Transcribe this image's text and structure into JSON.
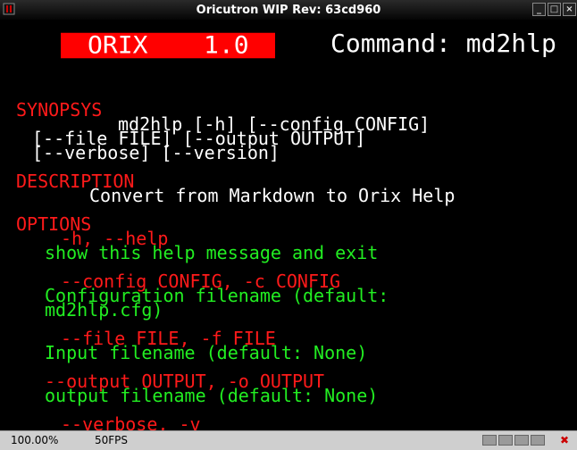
{
  "window": {
    "title": "Oricutron WIP Rev: 63cd960",
    "menu_icon": "window-menu-icon",
    "buttons": {
      "minimize": "_",
      "maximize": "□",
      "close": "×"
    }
  },
  "screen": {
    "banner": {
      "left": "ORIX",
      "right": "1.0"
    },
    "command": "Command: md2hlp",
    "lines": {
      "synopsys": "SYNOPSYS",
      "syn1": "md2hlp [-h] [--config CONFIG]",
      "syn2": "[--file FILE] [--output OUTPUT]",
      "syn3": "[--verbose] [--version]",
      "description": "DESCRIPTION",
      "desc_text": "Convert from Markdown to Orix Help",
      "options": "OPTIONS",
      "opt_h": "-h, --help",
      "opt_h_desc": "show this help message and exit",
      "opt_config": "--config CONFIG, -c CONFIG",
      "opt_config_desc1": "Configuration filename (default:",
      "opt_config_desc2": "md2hlp.cfg)",
      "opt_file": "--file FILE, -f FILE",
      "opt_file_desc": "Input filename (default: None)",
      "opt_output": "--output OUTPUT, -o OUTPUT",
      "opt_output_desc": "output filename (default: None)",
      "opt_verbose": "--verbose, -v"
    }
  },
  "status": {
    "zoom": "100.00%",
    "fps": "50FPS"
  },
  "colors": {
    "heading": "#ff1a1a",
    "option": "#22ee22",
    "text": "#ffffff",
    "banner_bg": "#ff0000"
  }
}
